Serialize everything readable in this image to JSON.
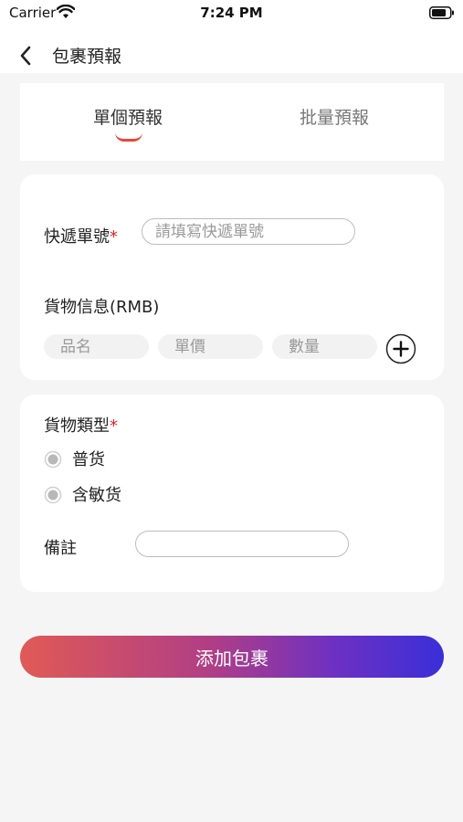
{
  "status_bar": {
    "carrier": "Carrier",
    "time": "7:24 PM",
    "wifi_icon": "wifi-icon",
    "battery_icon": "battery-icon"
  },
  "nav": {
    "back_icon": "chevron-left-icon",
    "title": "包裹預報"
  },
  "tabs": {
    "single": "單個預報",
    "batch": "批量預報",
    "active": "single",
    "active_color": "#e8463a"
  },
  "tracking": {
    "label": "快遞單號",
    "required_mark": "*",
    "placeholder": "請填寫快遞單號",
    "value": ""
  },
  "goods_info": {
    "label": "貨物信息(RMB)",
    "name_placeholder": "品名",
    "price_placeholder": "單價",
    "qty_placeholder": "數量",
    "add_icon": "plus-circle-icon"
  },
  "goods_type": {
    "label": "貨物類型",
    "required_mark": "*",
    "options": [
      {
        "label": "普货",
        "selected": false
      },
      {
        "label": "含敏货",
        "selected": false
      }
    ]
  },
  "remark": {
    "label": "備註",
    "value": ""
  },
  "submit": {
    "label": "添加包裹",
    "gradient_start": "#e05a55",
    "gradient_end": "#3a2fd8"
  }
}
